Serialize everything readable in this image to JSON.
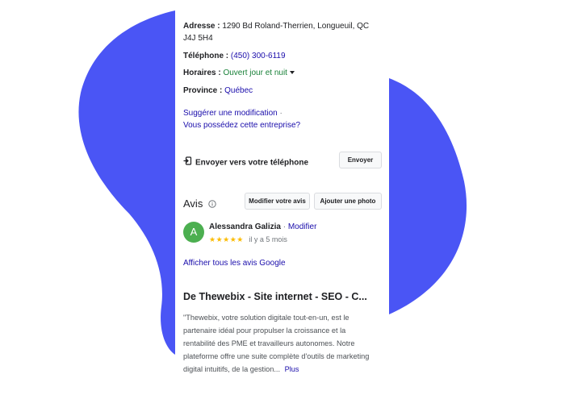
{
  "colors": {
    "blob": "#4a55f5",
    "link": "#1a0dab",
    "open_green": "#188038",
    "avatar": "#4caf50",
    "stars": "#fbbc04"
  },
  "info": {
    "address_label": "Adresse :",
    "address_value": "1290 Bd Roland-Therrien, Longueuil, QC",
    "address_value_2": "J4J 5H4",
    "phone_label": "Téléphone :",
    "phone_value": "(450) 300-6119",
    "hours_label": "Horaires :",
    "hours_value": "Ouvert jour et nuit",
    "province_label": "Province :",
    "province_value": "Québec"
  },
  "suggest": {
    "link1": "Suggérer une modification",
    "sep": " ·",
    "link2": "Vous possédez cette entreprise?"
  },
  "send": {
    "label": "Envoyer vers votre téléphone",
    "button": "Envoyer",
    "icon": "send-to-phone-icon"
  },
  "reviews": {
    "heading": "Avis",
    "info_icon": "info-icon",
    "edit_button": "Modifier votre avis",
    "add_photo_button": "Ajouter une photo",
    "review": {
      "avatar_letter": "A",
      "author": "Alessandra Galizia",
      "sep": " · ",
      "edit_link": "Modifier",
      "stars": "★★★★★",
      "rating": 5,
      "time": "il y a 5 mois"
    },
    "all_link": "Afficher tous les avis Google"
  },
  "about": {
    "title": "De Thewebix - Site internet - SEO - C...",
    "text": "\"Thewebix, votre solution digitale tout-en-un, est le partenaire idéal pour propulser la croissance et la rentabilité des PME et travailleurs autonomes. Notre plateforme offre une suite complète d'outils de marketing digital intuitifs, de la gestion...",
    "more_link": "Plus"
  }
}
